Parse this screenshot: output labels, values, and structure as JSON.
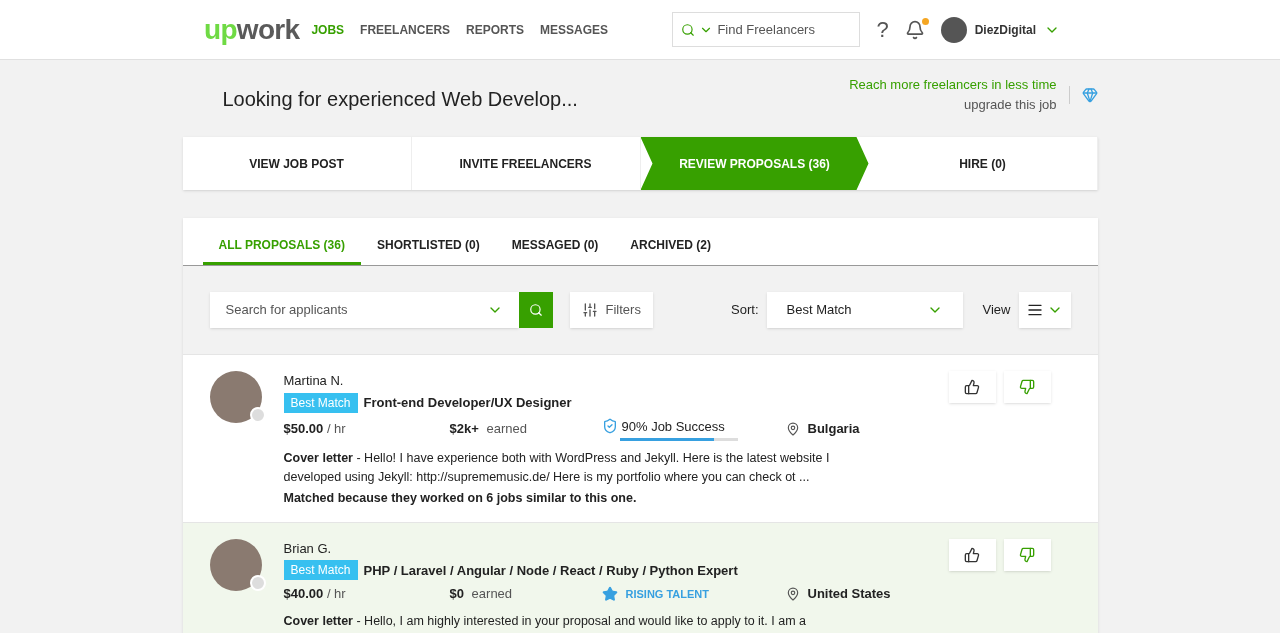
{
  "header": {
    "logo": "upwork",
    "nav": [
      {
        "label": "JOBS",
        "selected": true
      },
      {
        "label": "FREELANCERS",
        "selected": false
      },
      {
        "label": "REPORTS",
        "selected": false
      },
      {
        "label": "MESSAGES",
        "selected": false
      }
    ],
    "search": {
      "placeholder": "Find Freelancers"
    },
    "help": "?",
    "notifications": {
      "unread": true
    },
    "user": "DiezDigital"
  },
  "job": {
    "title": "Looking for experienced Web Develop...",
    "promo": "Reach more freelancers in less time",
    "upgrade": "upgrade this job"
  },
  "steps": [
    {
      "label": "VIEW JOB POST",
      "selected": false
    },
    {
      "label": "INVITE FREELANCERS",
      "selected": false
    },
    {
      "label": "REVIEW PROPOSALS (36)",
      "selected": true
    },
    {
      "label": "HIRE (0)",
      "selected": false
    }
  ],
  "tabs": [
    {
      "label": "ALL PROPOSALS (36)",
      "selected": true
    },
    {
      "label": "SHORTLISTED (0)",
      "selected": false
    },
    {
      "label": "MESSAGED (0)",
      "selected": false
    },
    {
      "label": "ARCHIVED (2)",
      "selected": false
    }
  ],
  "toolbar": {
    "search_placeholder": "Search for applicants",
    "filters": "Filters",
    "sort_label": "Sort:",
    "sort_value": "Best Match",
    "view_label": "View"
  },
  "proposals": [
    {
      "name": "Martina N.",
      "badge": "Best Match",
      "title": "Front-end Developer/UX Designer",
      "rate": "$50.00",
      "rate_unit": "/ hr",
      "earned": "$2k+",
      "earned_label": "earned",
      "status": {
        "kind": "job_success",
        "text": "90% Job Success",
        "level": 0.8
      },
      "location": "Bulgaria",
      "cover_label": "Cover letter",
      "cover": "- Hello! I have experience both with WordPress and Jekyll. Here is the latest website I developed using Jekyll: http://suprememusic.de/ Here is my portfolio where you can check ot ...",
      "matched": "Matched because they worked on 6 jobs similar to this one.",
      "highlighted": false
    },
    {
      "name": "Brian G.",
      "badge": "Best Match",
      "title": "PHP / Laravel / Angular / Node / React / Ruby / Python Expert",
      "rate": "$40.00",
      "rate_unit": "/ hr",
      "earned": "$0",
      "earned_label": "earned",
      "status": {
        "kind": "rising_talent",
        "text": "RISING TALENT"
      },
      "location": "United States",
      "cover_label": "Cover letter",
      "cover": "- Hello, I am highly interested in your proposal and would like to apply to it. I am a",
      "highlighted": true
    }
  ]
}
